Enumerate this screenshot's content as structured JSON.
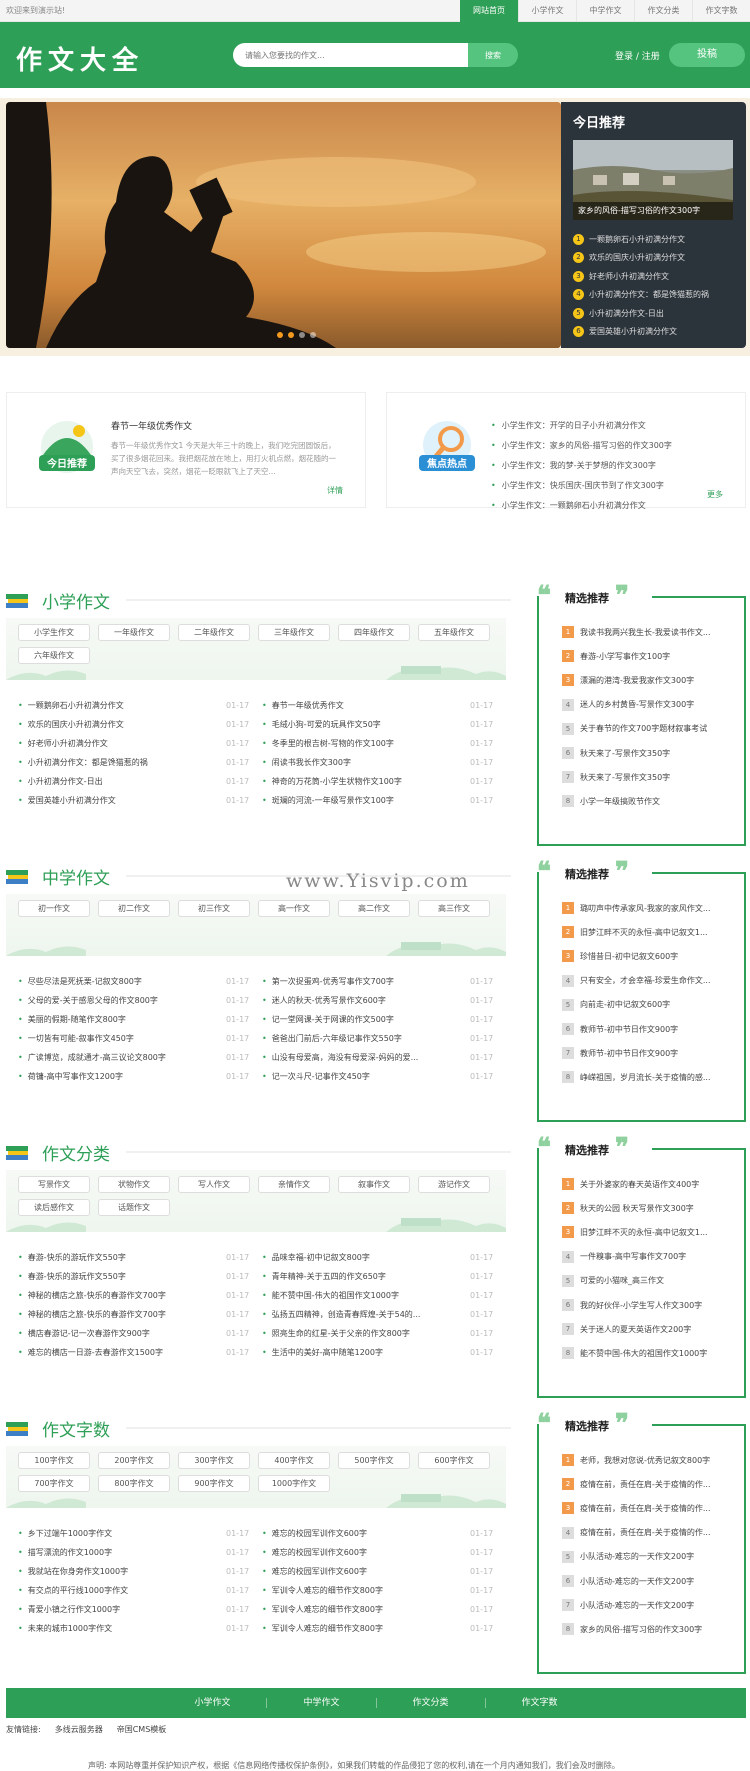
{
  "topbar": {
    "welcome": "欢迎来到演示站!",
    "nav": [
      "网站首页",
      "小学作文",
      "中学作文",
      "作文分类",
      "作文字数"
    ]
  },
  "header": {
    "logo": "作文大全",
    "search_placeholder": "请输入您要找的作文...",
    "search_button": "搜索",
    "login": "登录 / 注册",
    "post": "投稿"
  },
  "today": {
    "title": "今日推荐",
    "caption": "家乡的风俗-描写习俗的作文300字",
    "items": [
      "一颗鹅卵石小升初满分作文",
      "欢乐的国庆小升初满分作文",
      "好老师小升初满分作文",
      "小升初满分作文：都是馋猫惹的祸",
      "小升初满分作文-日出",
      "爱国英雄小升初满分作文"
    ]
  },
  "feature_left": {
    "icon_label": "今日推荐",
    "title": "春节一年级优秀作文",
    "text": "春节一年级优秀作文1 今天是大年三十的晚上，我们吃完团圆饭后，买了很多烟花回来。我把烟花放在地上，用打火机点燃，烟花随的一声向天空飞去，突然，烟花一眨眼就飞上了天空...",
    "more": "详情"
  },
  "feature_right": {
    "icon_label": "焦点热点",
    "items": [
      "小学生作文：开学的日子小升初满分作文",
      "小学生作文：家乡的风俗-描写习俗的作文300字",
      "小学生作文：我的梦-关于梦想的作文300字",
      "小学生作文：快乐国庆-国庆节到了作文300字",
      "小学生作文：一颗鹅卵石小升初满分作文"
    ],
    "more": "更多"
  },
  "sections": [
    {
      "title": "小学作文",
      "tags": [
        "小学生作文",
        "一年级作文",
        "二年级作文",
        "三年级作文",
        "四年级作文",
        "五年级作文",
        "六年级作文"
      ],
      "left": [
        [
          "一颗鹅卵石小升初满分作文",
          "01-17"
        ],
        [
          "欢乐的国庆小升初满分作文",
          "01-17"
        ],
        [
          "好老师小升初满分作文",
          "01-17"
        ],
        [
          "小升初满分作文：都是馋猫惹的祸",
          "01-17"
        ],
        [
          "小升初满分作文-日出",
          "01-17"
        ],
        [
          "爱国英雄小升初满分作文",
          "01-17"
        ]
      ],
      "right": [
        [
          "春节一年级优秀作文",
          "01-17"
        ],
        [
          "毛绒小狗-可爱的玩具作文50字",
          "01-17"
        ],
        [
          "冬季里的根吉树-写物的作文100字",
          "01-17"
        ],
        [
          "闹读书我长作文300字",
          "01-17"
        ],
        [
          "神奇的万花筒-小学生状物作文100字",
          "01-17"
        ],
        [
          "斑斓的河流-一年级写景作文100字",
          "01-17"
        ]
      ],
      "rec_title": "精选推荐",
      "rec": [
        "我读书我两兴我生长-我爱读书作文...",
        "春游-小学写事作文100字",
        "漂漏的港湾-我爱我家作文300字",
        "迷人的乡村黄昏-写景作文300字",
        "关于春节的作文700字题材叙事考试",
        "秋天来了-写景作文350字",
        "秋天来了-写景作文350字",
        "小学一年级搞败节作文"
      ]
    },
    {
      "title": "中学作文",
      "tags": [
        "初一作文",
        "初二作文",
        "初三作文",
        "高一作文",
        "高二作文",
        "高三作文"
      ],
      "left": [
        [
          "尽些尽法是死抚栗-记叙文800字",
          "01-17"
        ],
        [
          "父母的爱-关于感恩父母的作文800字",
          "01-17"
        ],
        [
          "美丽的假期-随笔作文800字",
          "01-17"
        ],
        [
          "一切皆有可能-叙事作文450字",
          "01-17"
        ],
        [
          "广读博览，成就通才-高三议论文800字",
          "01-17"
        ],
        [
          "荷镛-高中写事作文1200字",
          "01-17"
        ]
      ],
      "right": [
        [
          "第一次捉蛋鸡-优秀写事作文700字",
          "01-17"
        ],
        [
          "迷人的秋天-优秀写景作文600字",
          "01-17"
        ],
        [
          "记一堂网课-关于网课的作文500字",
          "01-17"
        ],
        [
          "爸爸出门前后-六年级记事作文550字",
          "01-17"
        ],
        [
          "山没有母爱高，海没有母爱深-妈妈的爱...",
          "01-17"
        ],
        [
          "记一次斗尺-记事作文450字",
          "01-17"
        ]
      ],
      "rec_title": "精选推荐",
      "rec": [
        "璐叨声中传承家风-我家的家风作文...",
        "旧梦江畔不灭的永恒-高中记叙文1...",
        "珍惜昔日-初中记叙文600字",
        "只有安全，才会幸福-珍爱生命作文...",
        "向前走-初中记叙文600字",
        "教师节-初中节日作文900字",
        "教师节-初中节日作文900字",
        "峥嵘祖国，岁月流长-关于疫情的感..."
      ]
    },
    {
      "title": "作文分类",
      "tags": [
        "写景作文",
        "状物作文",
        "写人作文",
        "亲情作文",
        "叙事作文",
        "游记作文",
        "读后感作文",
        "话题作文"
      ],
      "left": [
        [
          "春游-快乐的游玩作文550字",
          "01-17"
        ],
        [
          "春游-快乐的游玩作文550字",
          "01-17"
        ],
        [
          "神秘的横店之旅-快乐的春游作文700字",
          "01-17"
        ],
        [
          "神秘的横店之旅-快乐的春游作文700字",
          "01-17"
        ],
        [
          "横店春游记-记一次春游作文900字",
          "01-17"
        ],
        [
          "难忘的横店一日游-去春游作文1500字",
          "01-17"
        ]
      ],
      "right": [
        [
          "品味幸福-初中记叙文800字",
          "01-17"
        ],
        [
          "青年精神-关于五四的作文650字",
          "01-17"
        ],
        [
          "能不赞中国-伟大的祖国作文1000字",
          "01-17"
        ],
        [
          "弘扬五四精神，创造青春辉煌-关于54的...",
          "01-17"
        ],
        [
          "照亮生命的红星-关于父亲的作文800字",
          "01-17"
        ],
        [
          "生活中的美好-高中随笔1200字",
          "01-17"
        ]
      ],
      "rec_title": "精选推荐",
      "rec": [
        "关于外婆家的春天英语作文400字",
        "秋天的公园 秋天写景作文300字",
        "旧梦江畔不灭的永恒-高中记叙文1...",
        "一件糗事-高中写事作文700字",
        "可爱的小猫咪_高三作文",
        "我的好伙伴-小学生写人作文300字",
        "关于迷人的夏天英语作文200字",
        "能不赞中国-伟大的祖国作文1000字"
      ]
    },
    {
      "title": "作文字数",
      "tags": [
        "100字作文",
        "200字作文",
        "300字作文",
        "400字作文",
        "500字作文",
        "600字作文",
        "700字作文",
        "800字作文",
        "900字作文",
        "1000字作文"
      ],
      "left": [
        [
          "乡下过端午1000字作文",
          "01-17"
        ],
        [
          "描写漂流的作文1000字",
          "01-17"
        ],
        [
          "我就站在你身旁作文1000字",
          "01-17"
        ],
        [
          "有交点的平行线1000字作文",
          "01-17"
        ],
        [
          "青爱小镇之行作文1000字",
          "01-17"
        ],
        [
          "未来的城市1000字作文",
          "01-17"
        ]
      ],
      "right": [
        [
          "难忘的校园军训作文600字",
          "01-17"
        ],
        [
          "难忘的校园军训作文600字",
          "01-17"
        ],
        [
          "难忘的校园军训作文600字",
          "01-17"
        ],
        [
          "军训令人难忘的细节作文800字",
          "01-17"
        ],
        [
          "军训令人难忘的细节作文800字",
          "01-17"
        ],
        [
          "军训令人难忘的细节作文800字",
          "01-17"
        ]
      ],
      "rec_title": "精选推荐",
      "rec": [
        "老师，我想对您说-优秀记叙文800字",
        "疫情在前，责任在肩-关于疫情的作...",
        "疫情在前，责任在肩-关于疫情的作...",
        "疫情在前，责任在肩-关于疫情的作...",
        "小队活动-难忘的一天作文200字",
        "小队活动-难忘的一天作文200字",
        "小队活动-难忘的一天作文200字",
        "家乡的风俗-描写习俗的作文300字"
      ]
    }
  ],
  "watermark": "www.Yisvip.com",
  "footer": {
    "nav": [
      "小学作文",
      "中学作文",
      "作文分类",
      "作文字数"
    ],
    "links_label": "友情链接:",
    "links": [
      "多线云服务器",
      "帝国CMS模板"
    ],
    "declaration": "声明: 本网站尊重并保护知识产权，根据《信息网络传播权保护条例》，如果我们转载的作品侵犯了您的权利,请在一个月内通知我们，我们会及时删除。"
  },
  "colors": {
    "brand": "#2e9f56",
    "accent": "#55c47f",
    "hot": "#f39a4a"
  }
}
